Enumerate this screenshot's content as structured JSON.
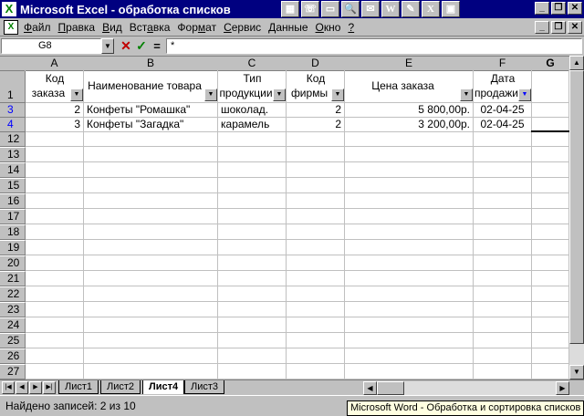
{
  "titlebar": {
    "title": "Microsoft Excel - обработка списков",
    "app_icon": "X"
  },
  "taskbar_icons": [
    {
      "name": "calc-icon",
      "glyph": "▦"
    },
    {
      "name": "phone-icon",
      "glyph": "☏"
    },
    {
      "name": "folder-icon",
      "glyph": "▭"
    },
    {
      "name": "search-icon",
      "glyph": "🔍"
    },
    {
      "name": "mail-icon",
      "glyph": "✉"
    },
    {
      "name": "word-icon",
      "glyph": "W"
    },
    {
      "name": "note-icon",
      "glyph": "✎"
    },
    {
      "name": "excel-icon",
      "glyph": "X"
    },
    {
      "name": "screen-icon",
      "glyph": "▣"
    }
  ],
  "menu": {
    "items": [
      {
        "u": "Ф",
        "rest": "айл"
      },
      {
        "u": "П",
        "rest": "равка"
      },
      {
        "u": "В",
        "rest": "ид"
      },
      {
        "u": "",
        "rest": "Вст",
        "u2": "а",
        "rest2": "вка"
      },
      {
        "u": "",
        "rest": "Фор",
        "u2": "м",
        "rest2": "ат"
      },
      {
        "u": "С",
        "rest": "ервис"
      },
      {
        "u": "Д",
        "rest": "анные"
      },
      {
        "u": "О",
        "rest": "кно"
      },
      {
        "u": "?",
        "rest": ""
      }
    ]
  },
  "formula_bar": {
    "name_box": "G8",
    "cancel": "✕",
    "ok": "✓",
    "equals": "=",
    "value": "*"
  },
  "columns": [
    "A",
    "B",
    "C",
    "D",
    "E",
    "F",
    "G"
  ],
  "header_row": {
    "row_label": "1",
    "cells": [
      {
        "line1": "Код",
        "line2": "заказа"
      },
      {
        "line1": "",
        "line2": "Наименование товара"
      },
      {
        "line1": "Тип",
        "line2": "продукции"
      },
      {
        "line1": "Код",
        "line2": "фирмы"
      },
      {
        "line1": "",
        "line2": "Цена заказа"
      },
      {
        "line1": "Дата",
        "line2": "продажи"
      }
    ]
  },
  "data_rows": [
    {
      "row_label": "3",
      "a": "2",
      "b": "Конфеты \"Ромашка\"",
      "c": "шоколад.",
      "d": "2",
      "e": "5 800,00р.",
      "f": "02-04-25"
    },
    {
      "row_label": "4",
      "a": "3",
      "b": "Конфеты \"Загадка\"",
      "c": "карамель",
      "d": "2",
      "e": "3 200,00р.",
      "f": "02-04-25"
    }
  ],
  "empty_rows": [
    "12",
    "13",
    "14",
    "15",
    "16",
    "17",
    "18",
    "19",
    "20",
    "21",
    "22",
    "23",
    "24",
    "25",
    "26",
    "27"
  ],
  "sheet_tabs": [
    "Лист1",
    "Лист2",
    "Лист4",
    "Лист3"
  ],
  "active_sheet": "Лист4",
  "status": {
    "text": "Найдено записей: 2 из 10"
  },
  "tooltip": "Microsoft Word - Обработка и сортировка списков"
}
